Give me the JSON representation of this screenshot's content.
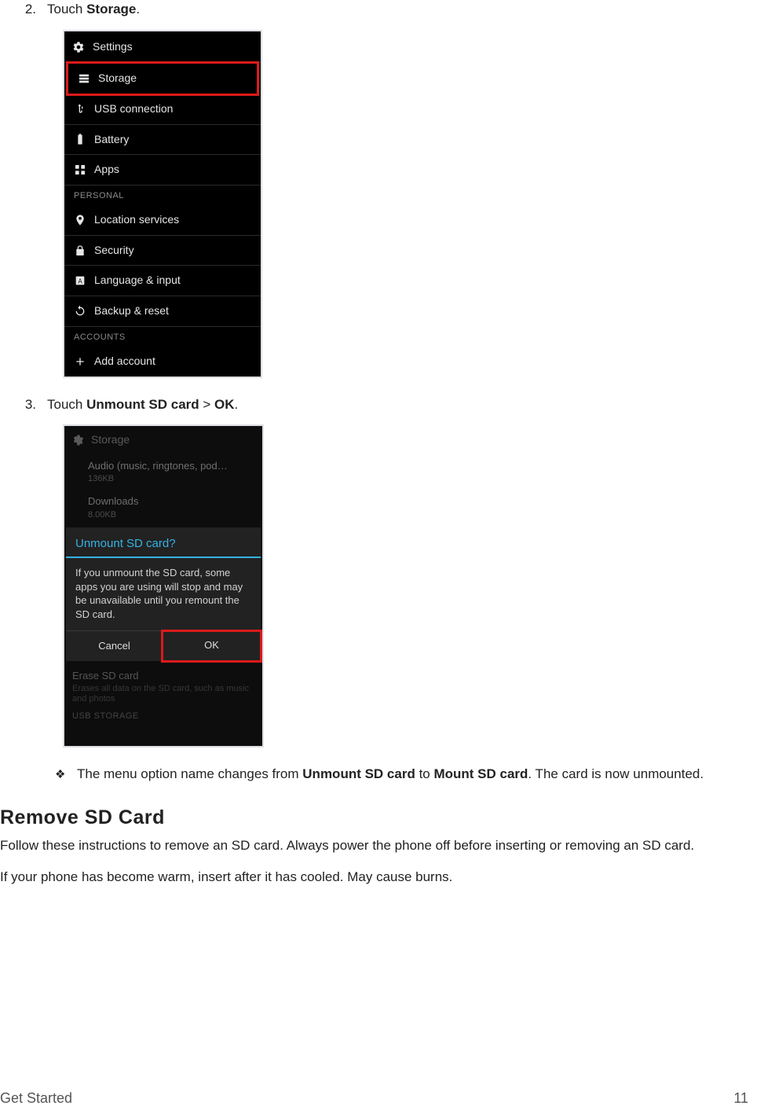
{
  "steps": {
    "s2": {
      "num": "2.",
      "pre": "Touch ",
      "bold": "Storage",
      "post": "."
    },
    "s3": {
      "num": "3.",
      "pre": "Touch ",
      "bold1": "Unmount SD card",
      "mid": " > ",
      "bold2": "OK",
      "post": "."
    }
  },
  "shot1": {
    "title": "Settings",
    "items": {
      "storage": "Storage",
      "usb": "USB connection",
      "battery": "Battery",
      "apps": "Apps"
    },
    "section_personal": "PERSONAL",
    "items2": {
      "location": "Location services",
      "security": "Security",
      "lang": "Language & input",
      "backup": "Backup & reset"
    },
    "section_accounts": "ACCOUNTS",
    "add_account": "Add account"
  },
  "shot2": {
    "head": "Storage",
    "audio_t1": "Audio (music, ringtones, pod…",
    "audio_t2": "136KB",
    "dl_t1": "Downloads",
    "dl_t2": "8.00KB",
    "dlg_title": "Unmount SD card?",
    "dlg_msg": "If you unmount the SD card, some apps you are using will stop and may be unavailable until you remount the SD card.",
    "cancel": "Cancel",
    "ok": "OK",
    "erase_t1": "Erase SD card",
    "erase_t2": "Erases all data on the SD card, such as music and photos",
    "usb_storage": "USB STORAGE"
  },
  "note": {
    "pre": "The menu option name changes from ",
    "b1": "Unmount SD card",
    "mid": " to ",
    "b2": "Mount SD card",
    "post": ". The card is now unmounted."
  },
  "section": {
    "title": "Remove SD Card",
    "p1": "Follow these instructions to remove an SD card. Always power the phone off before inserting or removing an SD card.",
    "p2": "If your phone has become warm, insert after it has cooled. May cause burns."
  },
  "footer": {
    "left": "Get Started",
    "right": "11"
  }
}
